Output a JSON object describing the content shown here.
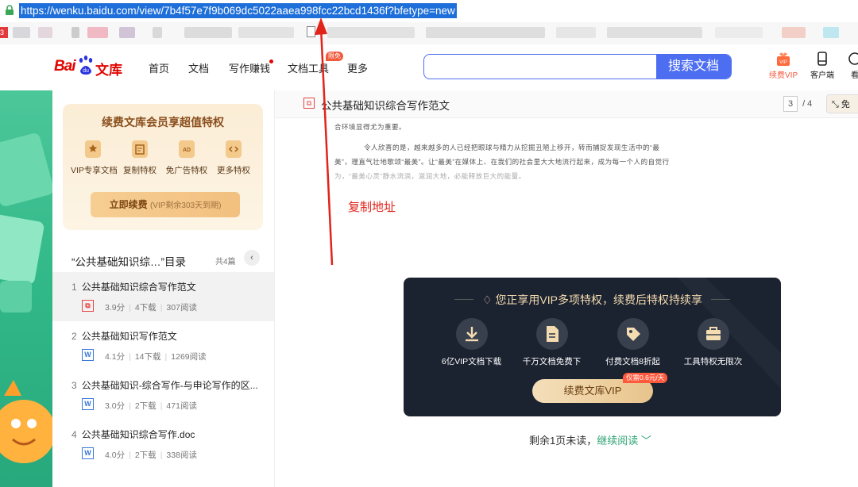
{
  "browser": {
    "url": "https://wenku.baidu.com/view/7b4f57e7f9b069dc5022aaea998fcc22bcd1436f?bfetype=new",
    "tab_badge": "3"
  },
  "header": {
    "logo_bai": "Bai",
    "logo_du": "du",
    "logo_wenku": "文库",
    "nav": [
      "首页",
      "文档",
      "写作赚钱",
      "文档工具",
      "更多"
    ],
    "nav_badge": "限免",
    "search_placeholder": "",
    "search_button": "搜索文档",
    "renew_vip": "续费VIP",
    "client": "客户端",
    "more_cut": "看"
  },
  "sidebar": {
    "vip_card": {
      "title": "续费文库会员享超值特权",
      "benefits": [
        {
          "label": "VIP专享文档",
          "icon": "star-doc-icon"
        },
        {
          "label": "复制特权",
          "icon": "copy-icon"
        },
        {
          "label": "免广告特权",
          "icon": "ad-icon"
        },
        {
          "label": "更多特权",
          "icon": "code-icon"
        }
      ],
      "button": "立即续费",
      "button_sub": "(VIP剩余303天到期)"
    },
    "toc_title": "“公共基础知识综…”目录",
    "toc_count": "共4篇",
    "items": [
      {
        "num": "1",
        "name": "公共基础知识综合写作范文",
        "type": "PDF",
        "score": "3.9分",
        "downloads": "4下载",
        "reads": "307阅读"
      },
      {
        "num": "2",
        "name": "公共基础知识写作范文",
        "type": "W",
        "score": "4.1分",
        "downloads": "14下载",
        "reads": "1269阅读"
      },
      {
        "num": "3",
        "name": "公共基础知识-综合写作-与申论写作的区...",
        "type": "W",
        "score": "3.0分",
        "downloads": "2下载",
        "reads": "471阅读"
      },
      {
        "num": "4",
        "name": "公共基础知识综合写作.doc",
        "type": "W",
        "score": "4.0分",
        "downloads": "2下载",
        "reads": "338阅读"
      }
    ]
  },
  "doc": {
    "title": "公共基础知识综合写作范文",
    "page_current": "3",
    "page_total": "/ 4",
    "fullscreen": "免",
    "lines": [
      "合环境显得尤为重要。",
      "令人欣喜的是，越来越多的人已经把眼球与精力从挖掘丑陋上移开，转而捕捉发现生活中的“最",
      "美”，理直气壮地歌颂“最美”。让“最美”在媒体上、在我们的社会里大大地流行起来，成为每一个人的自觉行",
      "为，“最美心灵”静水流淌，滋润大地，必能释放巨大的能量。"
    ]
  },
  "annotation": "复制地址",
  "vip_panel": {
    "title": "您正享用VIP多项特权，续费后特权持续享",
    "features": [
      {
        "label": "6亿VIP文档下载",
        "icon": "download-icon"
      },
      {
        "label": "千万文档免费下",
        "icon": "document-icon"
      },
      {
        "label": "付费文档8折起",
        "icon": "tag-icon"
      },
      {
        "label": "工具特权无限次",
        "icon": "toolbox-icon"
      }
    ],
    "button": "续费文库VIP",
    "tag": "仅需0.6元/天"
  },
  "remain": {
    "text": "剩余1页未读，",
    "link": "继续阅读"
  }
}
